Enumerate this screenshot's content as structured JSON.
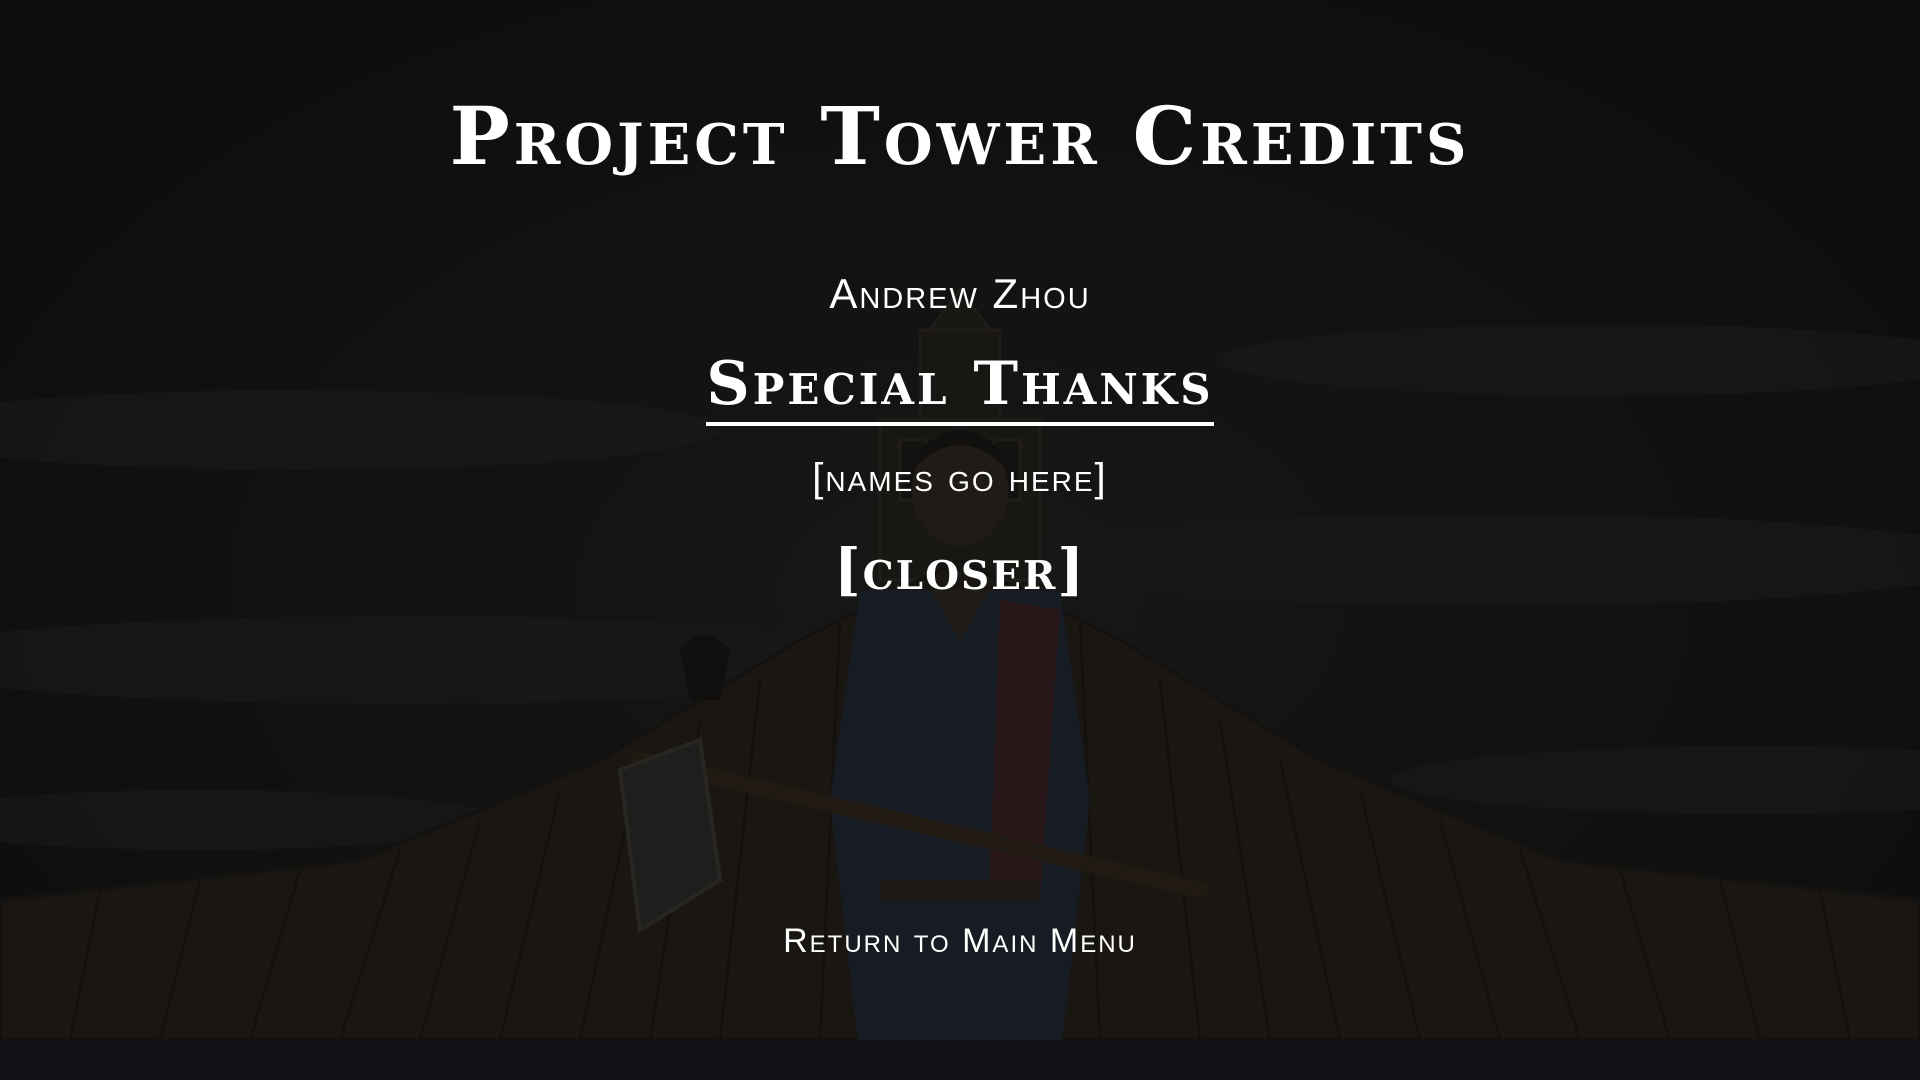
{
  "credits": {
    "title": "Project Tower Credits",
    "name": "Andrew Zhou",
    "special_thanks_heading": "Special Thanks",
    "special_thanks_names": "[names go here]",
    "closer": "[closer]"
  },
  "menu": {
    "return_label": "Return to Main Menu"
  },
  "colors": {
    "text": "#ffffff",
    "background": "#131415",
    "tower_wood": "#2a241d",
    "sky_cloud": "#1d1f21"
  }
}
